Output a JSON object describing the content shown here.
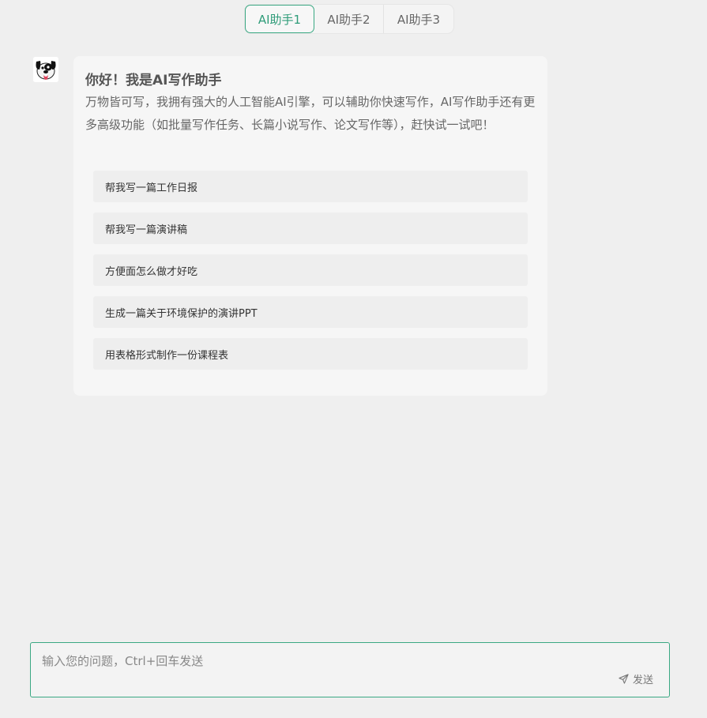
{
  "tabs": [
    {
      "label": "AI助手1",
      "active": true
    },
    {
      "label": "AI助手2",
      "active": false
    },
    {
      "label": "AI助手3",
      "active": false
    }
  ],
  "welcome": {
    "title": "你好！我是AI写作助手",
    "description": "万物皆可写，我拥有强大的人工智能AI引擎，可以辅助你快速写作，AI写作助手还有更多高级功能（如批量写作任务、长篇小说写作、论文写作等），赶快试一试吧！",
    "suggestions": [
      "帮我写一篇工作日报",
      "帮我写一篇演讲稿",
      "方便面怎么做才好吃",
      "生成一篇关于环境保护的演讲PPT",
      "用表格形式制作一份课程表"
    ]
  },
  "composer": {
    "placeholder": "输入您的问题，Ctrl+回车发送",
    "send_label": "发送"
  },
  "colors": {
    "accent": "#3aa883",
    "background": "#efefef",
    "card": "#f6f6f6"
  }
}
